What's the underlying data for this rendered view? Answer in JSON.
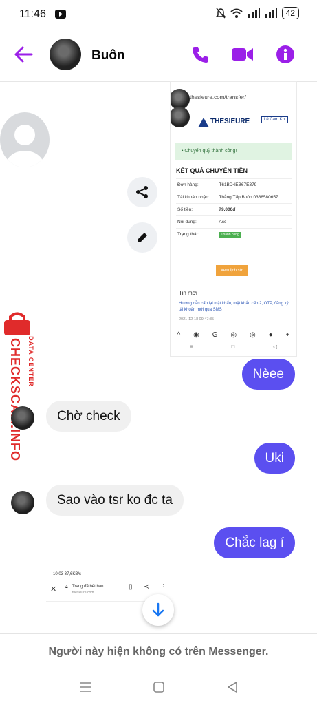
{
  "status": {
    "time": "11:46",
    "battery": "42"
  },
  "header": {
    "name": "Buôn",
    "accent": "#9b1fe8"
  },
  "screenshot": {
    "url": "thesieure.com/transfer/",
    "logo": "THESIEURE",
    "login": "Lê Cam Khi",
    "alert": "• Chuyển quỹ thành công!",
    "title": "KẾT QUẢ CHUYỂN TIỀN",
    "rows": [
      {
        "label": "Đơn hàng:",
        "value": "T61BD4EB67E379"
      },
      {
        "label": "Tài khoản nhận:",
        "value": "Thắng Tấp Buôn 0388580657"
      },
      {
        "label": "Số tiền:",
        "value": "79,000đ"
      },
      {
        "label": "Nội dung:",
        "value": "Acc"
      },
      {
        "label": "Trạng thái:",
        "value": "Thành công"
      }
    ],
    "history_button": "Xem lịch sử",
    "news_title": "Tin mới",
    "news_link": "Hướng dẫn cấp lại mật khẩu, mật khẩu cấp 2, OTP, đăng ký tài khoản mới qua SMS",
    "news_date": "2021-12-18 09:47:35"
  },
  "messages": [
    {
      "text": "Nèee",
      "side": "out"
    },
    {
      "text": "Chờ check",
      "side": "in"
    },
    {
      "text": "Uki",
      "side": "out"
    },
    {
      "text": "Sao vào tsr ko đc ta",
      "side": "in"
    },
    {
      "text": "Chắc lag í",
      "side": "out"
    }
  ],
  "screenshot2": {
    "time": "10:03 37,6KB/s",
    "title": "Trang đã hết hạn",
    "url": "thesieure.com"
  },
  "watermark": {
    "main": "CHECKSCAM.INFO",
    "sub": "DATA CENTER"
  },
  "footer": "Người này hiện không có trên Messenger.",
  "colors": {
    "out_bubble": "#5b4ff0",
    "in_bubble": "#f0f0f0",
    "accent": "#9b1fe8"
  }
}
